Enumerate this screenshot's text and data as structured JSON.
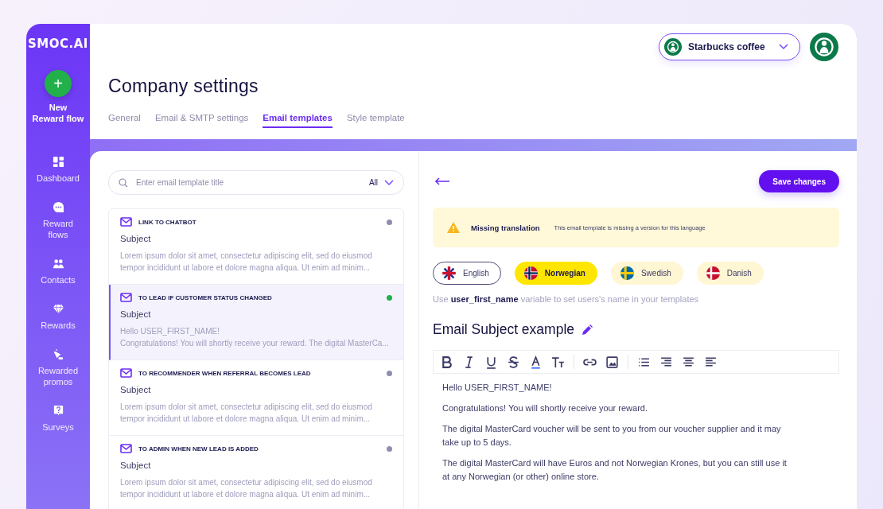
{
  "sidebar": {
    "logo": "SMOC.AI",
    "new_button": {
      "icon": "+",
      "label": "New Reward flow"
    },
    "items": [
      {
        "kind": "dashboard",
        "label": "Dashboard"
      },
      {
        "kind": "chat",
        "label": "Reward flows"
      },
      {
        "kind": "people",
        "label": "Contacts"
      },
      {
        "kind": "diamond",
        "label": "Rewards"
      },
      {
        "kind": "megaphone",
        "label": "Rewarded promos"
      },
      {
        "kind": "question",
        "label": "Surveys"
      }
    ]
  },
  "company_selector": {
    "label": "Starbucks coffee"
  },
  "page_title": "Company settings",
  "tabs": [
    {
      "label": "General",
      "selected": false
    },
    {
      "label": "Email & SMTP settings",
      "selected": false
    },
    {
      "label": "Email templates",
      "selected": true
    },
    {
      "label": "Style template",
      "selected": false
    }
  ],
  "search": {
    "placeholder": "Enter email template title",
    "filter": "All"
  },
  "templates": [
    {
      "title": "LINK TO CHATBOT",
      "subject": "Subject",
      "color": "#8e8eb0",
      "selected": false,
      "preview": [
        "Lorem ipsum dolor sit amet, consectetur adipiscing elit, sed do eiusmod tempor incididunt ut labore et dolore magna aliqua. Ut enim ad minim..."
      ]
    },
    {
      "title": "TO LEAD IF CUSTOMER STATUS CHANGED",
      "subject": "Subject",
      "color": "#22b04b",
      "selected": true,
      "preview": [
        "Hello USER_FIRST_NAME!",
        "Congratulations! You will shortly receive your reward. The digital MasterCa..."
      ]
    },
    {
      "title": "TO RECOMMENDER WHEN REFERRAL BECOMES LEAD",
      "subject": "Subject",
      "color": "#8e8eb0",
      "selected": false,
      "preview": [
        "Lorem ipsum dolor sit amet, consectetur adipiscing elit, sed do eiusmod tempor incididunt ut labore et dolore magna aliqua. Ut enim ad minim..."
      ]
    },
    {
      "title": "TO  ADMIN WHEN NEW LEAD IS ADDED",
      "subject": "Subject",
      "color": "#8e8eb0",
      "selected": false,
      "preview": [
        "Lorem ipsum dolor sit amet, consectetur adipiscing elit, sed do eiusmod tempor incididunt ut labore et dolore magna aliqua. Ut enim ad minim..."
      ]
    }
  ],
  "save_button": "Save changes",
  "alert": {
    "title": "Missing translation",
    "message": "This email template is missing a version for this language"
  },
  "languages": [
    {
      "kind": "uk",
      "label": "English",
      "selected": false,
      "default": true,
      "missing": false
    },
    {
      "kind": "no",
      "label": "Norwegian",
      "selected": true,
      "default": false,
      "missing": true
    },
    {
      "kind": "se",
      "label": "Swedish",
      "selected": false,
      "default": false,
      "missing": true
    },
    {
      "kind": "dk",
      "label": "Danish",
      "selected": false,
      "default": false,
      "missing": true
    }
  ],
  "hint": "Use **user_first_name** variable to set users's name in your templates",
  "subject_title": "Email Subject example",
  "body": [
    "Hello USER_FIRST_NAME!",
    "Congratulations! You will shortly receive your reward.",
    "The digital MasterCard voucher will be sent to you from our voucher supplier and it may take up to 5 days.",
    "The digital MasterCard will have Euros and not Norwegian Krones, but you can still use it at any Norwegian (or other) online store."
  ]
}
